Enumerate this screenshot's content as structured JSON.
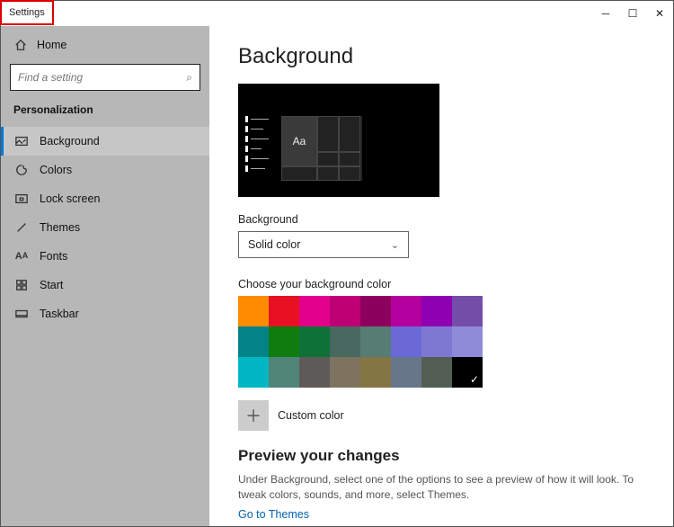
{
  "window": {
    "app_title": "Settings"
  },
  "sidebar": {
    "home_label": "Home",
    "search_placeholder": "Find a setting",
    "category": "Personalization",
    "items": [
      {
        "label": "Background",
        "icon": "picture-icon",
        "active": true
      },
      {
        "label": "Colors",
        "icon": "palette-icon"
      },
      {
        "label": "Lock screen",
        "icon": "lock-icon"
      },
      {
        "label": "Themes",
        "icon": "brush-icon"
      },
      {
        "label": "Fonts",
        "icon": "font-icon"
      },
      {
        "label": "Start",
        "icon": "start-icon"
      },
      {
        "label": "Taskbar",
        "icon": "taskbar-icon"
      }
    ]
  },
  "main": {
    "title": "Background",
    "preview_sample_text": "Aa",
    "bg_label": "Background",
    "bg_value": "Solid color",
    "colors_label": "Choose your background color",
    "colors": [
      "#ff8c00",
      "#e81123",
      "#e3008c",
      "#bd0073",
      "#8e005d",
      "#b4009e",
      "#8f00b3",
      "#744da9",
      "#038387",
      "#107c10",
      "#0e7138",
      "#486860",
      "#567c73",
      "#6b69d6",
      "#7e79d0",
      "#8e8cd8",
      "#00b7c3",
      "#508477",
      "#5d5a58",
      "#7e735f",
      "#847545",
      "#68768a",
      "#525e54",
      "#000000"
    ],
    "selected_color_index": 23,
    "custom_label": "Custom color",
    "preview_heading": "Preview your changes",
    "preview_desc": "Under Background, select one of the options to see a preview of how it will look. To tweak colors, sounds, and more, select Themes.",
    "themes_link": "Go to Themes"
  }
}
